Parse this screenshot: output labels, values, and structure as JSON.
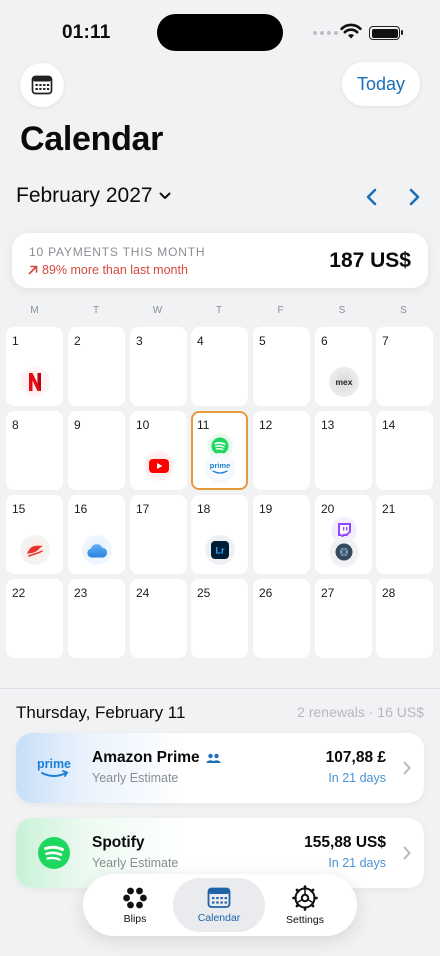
{
  "status_bar": {
    "time": "01:11"
  },
  "header": {
    "title": "Calendar",
    "today_label": "Today"
  },
  "month": {
    "label": "February 2027"
  },
  "summary": {
    "count_label": "10 PAYMENTS THIS MONTH",
    "trend_label": "89% more than last month",
    "total": "187 US$",
    "trend_color": "#d4493d"
  },
  "weekdays": [
    "M",
    "T",
    "W",
    "T",
    "F",
    "S",
    "S"
  ],
  "days": [
    {
      "n": "1",
      "icons": [
        "netflix-icon"
      ]
    },
    {
      "n": "2",
      "icons": []
    },
    {
      "n": "3",
      "icons": []
    },
    {
      "n": "4",
      "icons": []
    },
    {
      "n": "5",
      "icons": []
    },
    {
      "n": "6",
      "icons": [
        "mex-icon"
      ]
    },
    {
      "n": "7",
      "icons": []
    },
    {
      "n": "8",
      "icons": []
    },
    {
      "n": "9",
      "icons": []
    },
    {
      "n": "10",
      "icons": [
        "youtube-icon"
      ]
    },
    {
      "n": "11",
      "icons": [
        "spotify-icon",
        "amazon-prime-icon"
      ],
      "selected": true
    },
    {
      "n": "12",
      "icons": []
    },
    {
      "n": "13",
      "icons": []
    },
    {
      "n": "14",
      "icons": []
    },
    {
      "n": "15",
      "icons": [
        "brand-red-icon"
      ]
    },
    {
      "n": "16",
      "icons": [
        "icloud-icon"
      ]
    },
    {
      "n": "17",
      "icons": []
    },
    {
      "n": "18",
      "icons": [
        "lightroom-icon"
      ]
    },
    {
      "n": "19",
      "icons": []
    },
    {
      "n": "20",
      "icons": [
        "twitch-icon",
        "gear-app-icon"
      ]
    },
    {
      "n": "21",
      "icons": []
    },
    {
      "n": "22",
      "icons": []
    },
    {
      "n": "23",
      "icons": []
    },
    {
      "n": "24",
      "icons": []
    },
    {
      "n": "25",
      "icons": []
    },
    {
      "n": "26",
      "icons": []
    },
    {
      "n": "27",
      "icons": []
    },
    {
      "n": "28",
      "icons": []
    }
  ],
  "selected_day": {
    "label": "Thursday, February 11",
    "meta": "2 renewals · 16 US$"
  },
  "subscriptions": [
    {
      "name": "Amazon Prime",
      "estimate": "Yearly Estimate",
      "price": "107,88 £",
      "due": "In 21 days",
      "logo_text": "prime",
      "shared": true
    },
    {
      "name": "Spotify",
      "estimate": "Yearly Estimate",
      "price": "155,88 US$",
      "due": "In 21 days",
      "shared": false
    }
  ],
  "tabs": [
    {
      "label": "Blips",
      "icon": "blips-icon"
    },
    {
      "label": "Calendar",
      "icon": "calendar-icon",
      "active": true
    },
    {
      "label": "Settings",
      "icon": "gear-icon"
    }
  ],
  "colors": {
    "accent": "#1a6fb8",
    "selected_border": "#e59a3b",
    "due": "#4b93d6"
  }
}
